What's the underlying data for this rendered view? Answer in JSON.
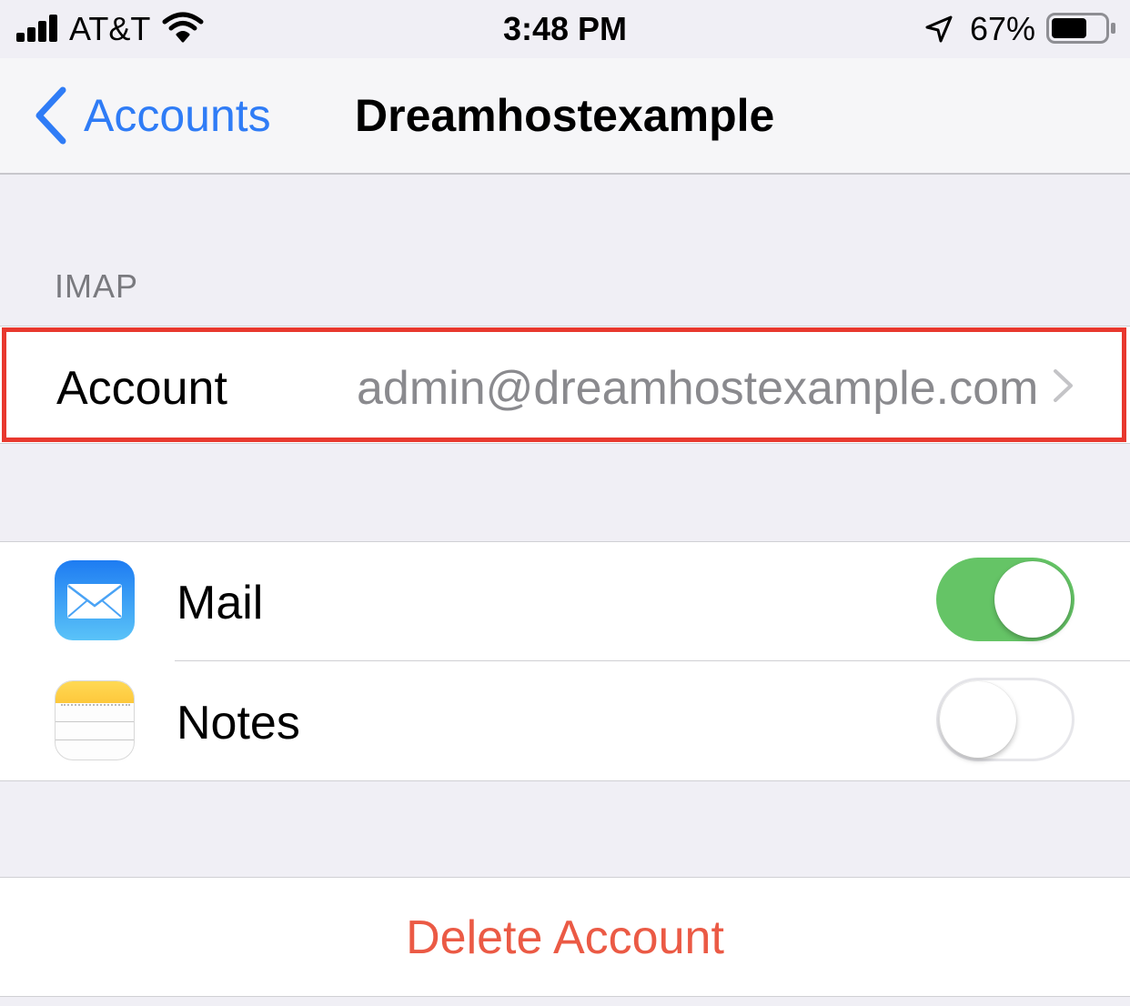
{
  "status_bar": {
    "carrier": "AT&T",
    "time": "3:48 PM",
    "battery_percent": "67%",
    "battery_level": 0.67,
    "icons": [
      "signal-icon",
      "wifi-icon",
      "location-arrow-icon",
      "battery-icon"
    ]
  },
  "nav": {
    "back_label": "Accounts",
    "title": "Dreamhostexample"
  },
  "section": {
    "header": "IMAP"
  },
  "account_row": {
    "label": "Account",
    "value": "admin@dreamhostexample.com"
  },
  "apps": {
    "items": [
      {
        "label": "Mail",
        "icon": "mail-app-icon",
        "enabled": true
      },
      {
        "label": "Notes",
        "icon": "notes-app-icon",
        "enabled": false
      }
    ]
  },
  "delete": {
    "label": "Delete Account"
  },
  "colors": {
    "accent_blue": "#2f7cf6",
    "toggle_on_green": "#65c466",
    "destructive_red": "#eb5a45",
    "highlight_red": "#e8382e",
    "background": "#f0eff5"
  }
}
